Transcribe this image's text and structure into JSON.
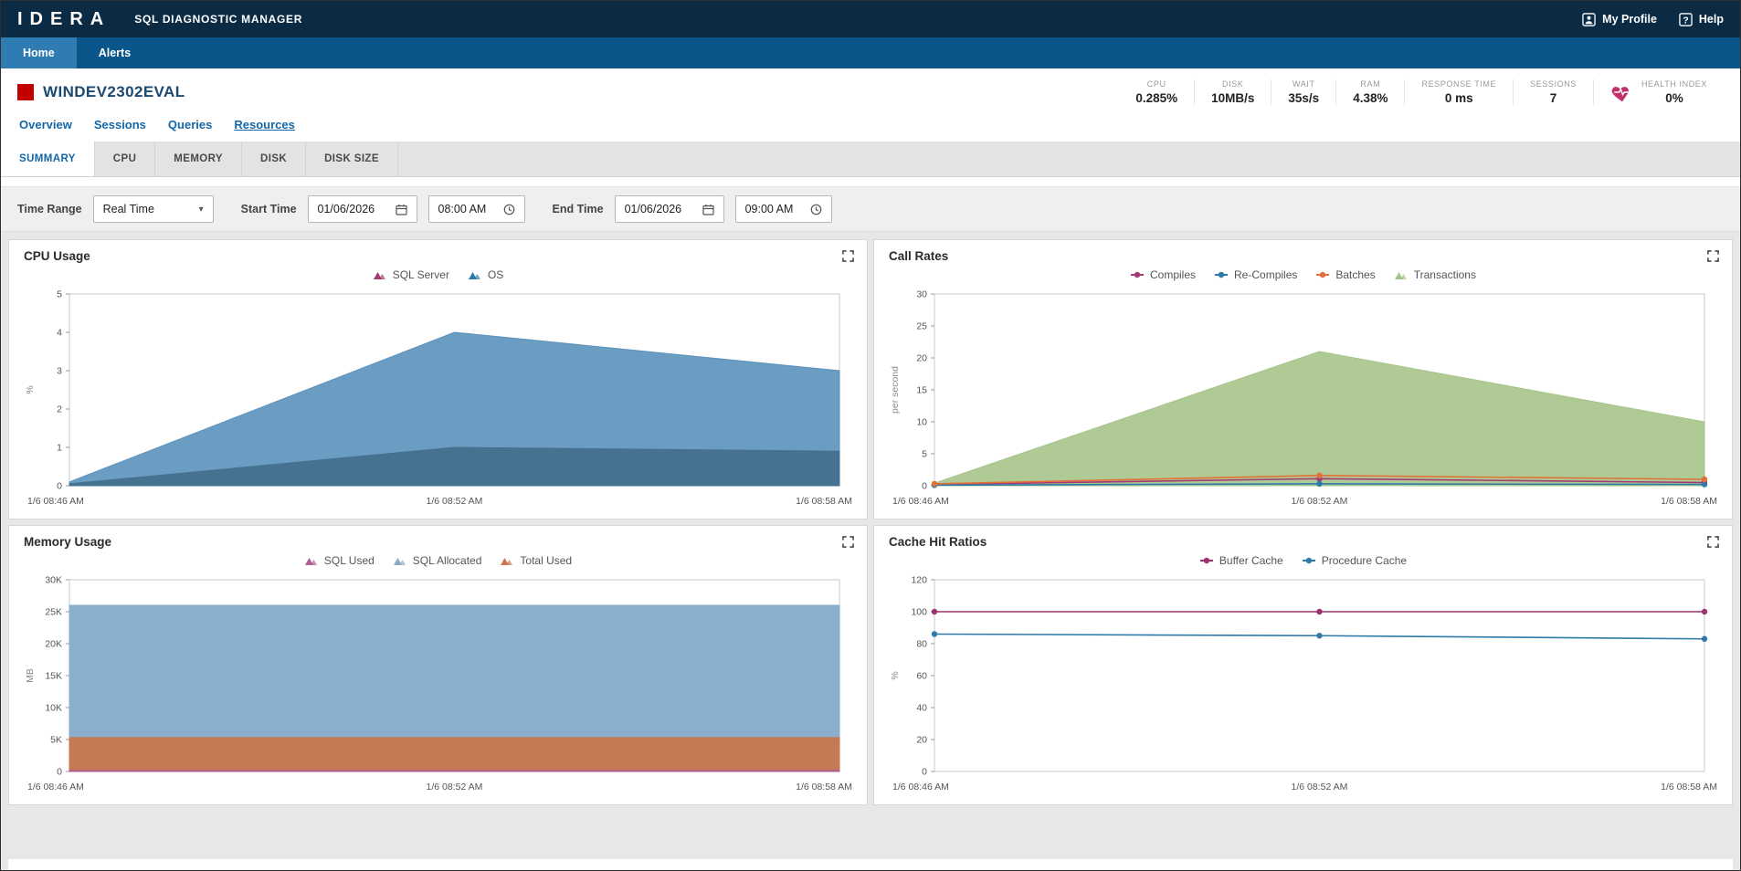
{
  "header": {
    "logo": "IDERA",
    "app_title": "SQL DIAGNOSTIC MANAGER",
    "my_profile": "My Profile",
    "help": "Help"
  },
  "nav": {
    "tabs": [
      {
        "label": "Home",
        "active": true
      },
      {
        "label": "Alerts",
        "active": false
      }
    ]
  },
  "server": {
    "name": "WINDEV2302EVAL",
    "stats": [
      {
        "id": "cpu",
        "label": "CPU",
        "value": "0.285%"
      },
      {
        "id": "disk",
        "label": "DISK",
        "value": "10MB/s"
      },
      {
        "id": "wait",
        "label": "WAIT",
        "value": "35s/s"
      },
      {
        "id": "ram",
        "label": "RAM",
        "value": "4.38%"
      },
      {
        "id": "response-time",
        "label": "RESPONSE TIME",
        "value": "0 ms"
      },
      {
        "id": "sessions",
        "label": "SESSIONS",
        "value": "7"
      },
      {
        "id": "health-index",
        "label": "HEALTH INDEX",
        "value": "0%",
        "icon": "heart-icon"
      }
    ]
  },
  "subnav": {
    "items": [
      "Overview",
      "Sessions",
      "Queries",
      "Resources"
    ],
    "active": 3
  },
  "resource_tabs": {
    "items": [
      "SUMMARY",
      "CPU",
      "MEMORY",
      "DISK",
      "DISK SIZE"
    ],
    "active": 0
  },
  "filters": {
    "time_range_label": "Time Range",
    "time_range_value": "Real Time",
    "start_time_label": "Start Time",
    "start_date": "01/06/2026",
    "start_time": "08:00 AM",
    "end_time_label": "End Time",
    "end_date": "01/06/2026",
    "end_time": "09:00 AM"
  },
  "colors": {
    "accent_blue": "#1467a8",
    "header_navy": "#0b2b45",
    "nav_blue": "#0a568a",
    "status_red": "#c40000",
    "health_heart": "#c2306b"
  },
  "chart_data": [
    {
      "id": "cpu-usage",
      "title": "CPU Usage",
      "type": "area",
      "x": [
        "1/6 08:46 AM",
        "1/6 08:52 AM",
        "1/6 08:58 AM"
      ],
      "ylabel": "%",
      "ylim": [
        0,
        5
      ],
      "yticks": [
        0,
        1,
        2,
        3,
        4,
        5
      ],
      "ytick_labels": [
        "0",
        "1",
        "2",
        "3",
        "4",
        "5"
      ],
      "legend_position": "top",
      "grid": false,
      "series": [
        {
          "name": "SQL Server",
          "kind": "area",
          "color": "#45708f",
          "legend_color": "#a33a70",
          "opacity": 0.95,
          "values": [
            0.05,
            1.0,
            0.9
          ]
        },
        {
          "name": "OS",
          "kind": "area",
          "color": "#5b91bb",
          "legend_color": "#2e7aa8",
          "opacity": 0.9,
          "values": [
            0.1,
            4.0,
            3.0
          ]
        }
      ]
    },
    {
      "id": "call-rates",
      "title": "Call Rates",
      "type": "area",
      "x": [
        "1/6 08:46 AM",
        "1/6 08:52 AM",
        "1/6 08:58 AM"
      ],
      "ylabel": "per second",
      "ylim": [
        0,
        30
      ],
      "yticks": [
        0,
        5,
        10,
        15,
        20,
        25,
        30
      ],
      "ytick_labels": [
        "0",
        "5",
        "10",
        "15",
        "20",
        "25",
        "30"
      ],
      "legend_position": "top",
      "grid": false,
      "series": [
        {
          "name": "Compiles",
          "kind": "line",
          "color": "#a23a74",
          "values": [
            0.2,
            1.1,
            0.5
          ]
        },
        {
          "name": "Re-Compiles",
          "kind": "line",
          "color": "#2e7aa8",
          "values": [
            0.1,
            0.3,
            0.2
          ]
        },
        {
          "name": "Batches",
          "kind": "line",
          "color": "#e2703a",
          "values": [
            0.3,
            1.6,
            1.0
          ]
        },
        {
          "name": "Transactions",
          "kind": "area",
          "color": "#a6c489",
          "opacity": 0.9,
          "values": [
            0.4,
            21,
            10
          ]
        }
      ]
    },
    {
      "id": "memory-usage",
      "title": "Memory Usage",
      "type": "area",
      "x": [
        "1/6 08:46 AM",
        "1/6 08:52 AM",
        "1/6 08:58 AM"
      ],
      "ylabel": "MB",
      "ylim": [
        0,
        30000
      ],
      "yticks": [
        0,
        5000,
        10000,
        15000,
        20000,
        25000,
        30000
      ],
      "ytick_labels": [
        "0",
        "5K",
        "10K",
        "15K",
        "20K",
        "25K",
        "30K"
      ],
      "legend_position": "top",
      "grid": false,
      "series": [
        {
          "name": "SQL Used",
          "kind": "area",
          "color": "#b05c8e",
          "opacity": 0.95,
          "values": [
            180,
            180,
            180
          ]
        },
        {
          "name": "SQL Allocated",
          "kind": "area",
          "color": "#84abc9",
          "opacity": 0.95,
          "values": [
            26000,
            26000,
            26000
          ]
        },
        {
          "name": "Total Used",
          "kind": "area",
          "color": "#c9764e",
          "opacity": 0.95,
          "values": [
            5300,
            5300,
            5300
          ]
        }
      ]
    },
    {
      "id": "cache-hit-ratios",
      "title": "Cache Hit Ratios",
      "type": "line",
      "x": [
        "1/6 08:46 AM",
        "1/6 08:52 AM",
        "1/6 08:58 AM"
      ],
      "ylabel": "%",
      "ylim": [
        0,
        120
      ],
      "yticks": [
        0,
        20,
        40,
        60,
        80,
        100,
        120
      ],
      "ytick_labels": [
        "0",
        "20",
        "40",
        "60",
        "80",
        "100",
        "120"
      ],
      "legend_position": "top",
      "grid": false,
      "series": [
        {
          "name": "Buffer Cache",
          "kind": "line",
          "color": "#9c3270",
          "values": [
            100,
            100,
            100
          ]
        },
        {
          "name": "Procedure Cache",
          "kind": "line",
          "color": "#2e7aa8",
          "values": [
            86,
            85,
            83
          ]
        }
      ]
    }
  ]
}
